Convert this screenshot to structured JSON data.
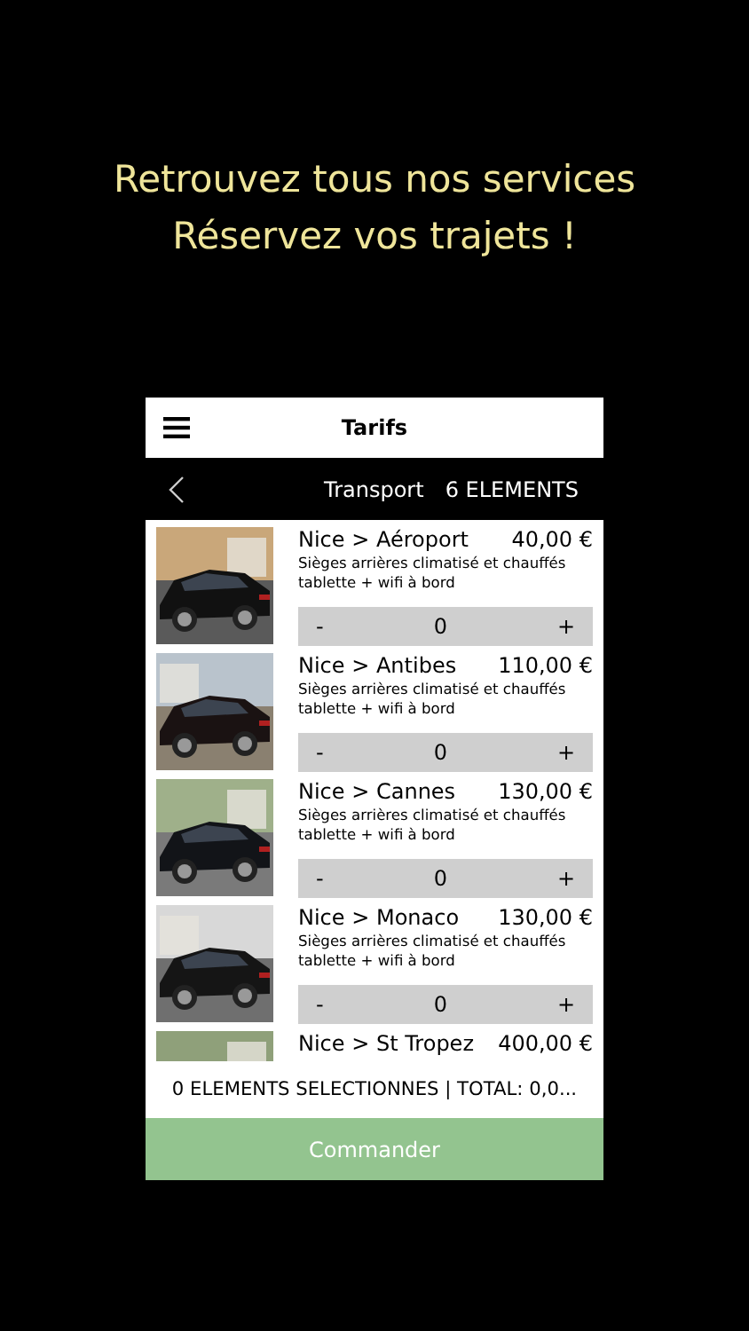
{
  "headline": [
    "Retrouvez tous nos services",
    "Réservez vos trajets !"
  ],
  "header": {
    "title": "Tarifs"
  },
  "subbar": {
    "category": "Transport",
    "count": "6 ELEMENTS"
  },
  "items": [
    {
      "name": "Nice > Aéroport",
      "price": "40,00 €",
      "description": "Sièges arrières climatisé et chauffés tablette + wifi à bord",
      "minus": "-",
      "quantity": "0",
      "plus": "+"
    },
    {
      "name": "Nice > Antibes",
      "price": "110,00 €",
      "description": "Sièges arrières climatisé et chauffés tablette + wifi à bord",
      "minus": "-",
      "quantity": "0",
      "plus": "+"
    },
    {
      "name": "Nice > Cannes",
      "price": "130,00 €",
      "description": "Sièges arrières climatisé et chauffés tablette + wifi à bord",
      "minus": "-",
      "quantity": "0",
      "plus": "+"
    },
    {
      "name": "Nice > Monaco",
      "price": "130,00 €",
      "description": "Sièges arrières climatisé et chauffés tablette + wifi à bord",
      "minus": "-",
      "quantity": "0",
      "plus": "+"
    },
    {
      "name": "Nice > St Tropez",
      "price": "400,00 €"
    }
  ],
  "summary": "0 ELEMENTS SELECTIONNES | TOTAL: 0,0...",
  "order_button": "Commander"
}
